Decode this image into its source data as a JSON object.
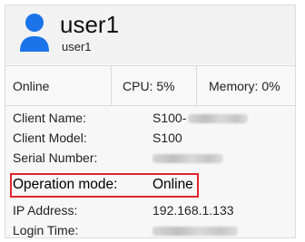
{
  "user": {
    "name": "user1",
    "username": "user1"
  },
  "stats": {
    "status": "Online",
    "cpu": "CPU: 5%",
    "memory": "Memory: 0%"
  },
  "details": {
    "client_name_label": "Client Name:",
    "client_name_prefix": "S100-",
    "client_model_label": "Client Model:",
    "client_model_value": "S100",
    "serial_number_label": "Serial Number:",
    "operation_mode_label": "Operation mode:",
    "operation_mode_value": "Online",
    "ip_address_label": "IP Address:",
    "ip_address_value": "192.168.1.133",
    "login_time_label": "Login Time:"
  },
  "colors": {
    "highlight": "#e0262d",
    "avatar": "#1a73e8"
  },
  "icons": {
    "avatar": "user-avatar-icon"
  }
}
